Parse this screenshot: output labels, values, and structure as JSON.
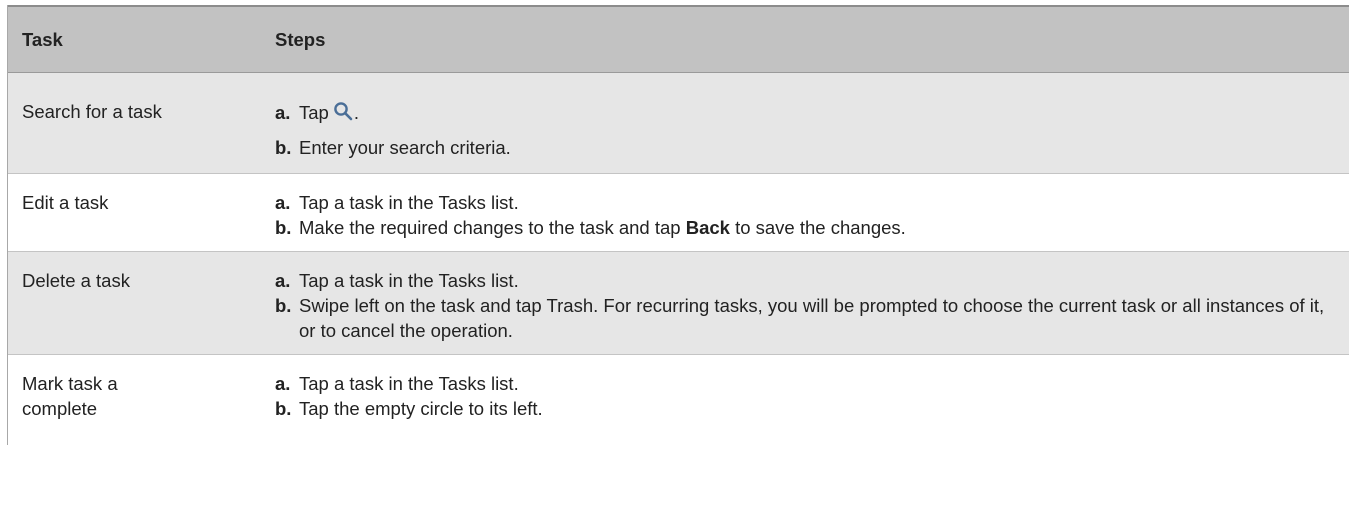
{
  "header": {
    "task": "Task",
    "steps": "Steps"
  },
  "rows": [
    {
      "task": "Search for a task",
      "step_a_prefix": "Tap",
      "step_a_suffix": ".",
      "step_b": "Enter your search criteria."
    },
    {
      "task": "Edit a task",
      "step_a": "Tap a task in the Tasks list.",
      "step_b_before": "Make the required changes to the task and tap ",
      "step_b_bold": "Back",
      "step_b_after": " to save the changes."
    },
    {
      "task": "Delete a task",
      "step_a": "Tap a task in the Tasks list.",
      "step_b": "Swipe left on the task and tap Trash. For recurring tasks, you will be prompted to choose the current task or all instances of it, or to cancel the operation."
    },
    {
      "task_line1": "Mark task a",
      "task_line2": "complete",
      "step_a": "Tap a task in the Tasks list.",
      "step_b": "Tap the empty circle to its left."
    }
  ],
  "markers": {
    "a": "a.",
    "b": "b."
  },
  "icons": {
    "search": "search-icon"
  },
  "colors": {
    "header_bg": "#c2c2c2",
    "shaded_row_bg": "#e6e6e6",
    "icon": "#4a6e97"
  }
}
